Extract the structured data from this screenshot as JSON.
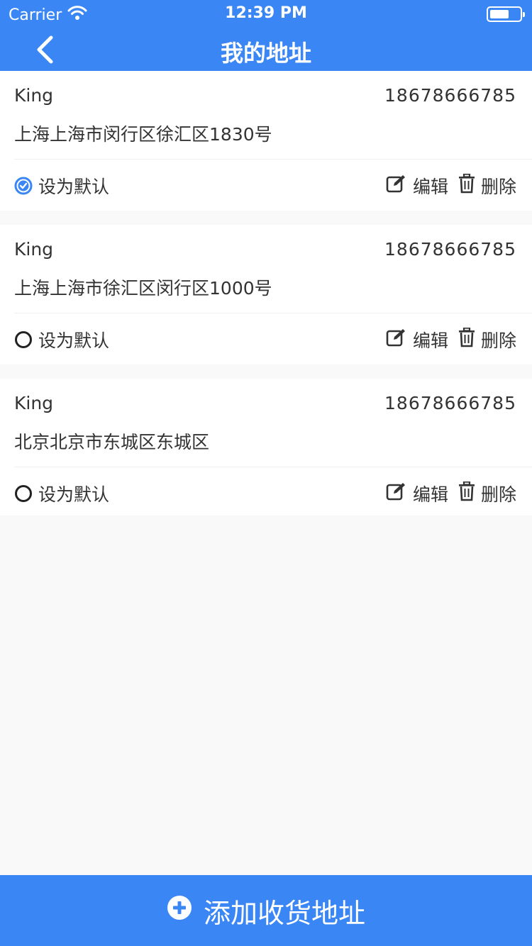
{
  "status_bar": {
    "carrier": "Carrier",
    "time": "12:39 PM"
  },
  "header": {
    "title": "我的地址"
  },
  "addresses": [
    {
      "name": "King",
      "phone": "18678666785",
      "address": "上海上海市闵行区徐汇区1830号",
      "default_label": "设为默认",
      "is_default": true,
      "edit_label": "编辑",
      "delete_label": "删除"
    },
    {
      "name": "King",
      "phone": "18678666785",
      "address": "上海上海市徐汇区闵行区1000号",
      "default_label": "设为默认",
      "is_default": false,
      "edit_label": "编辑",
      "delete_label": "删除"
    },
    {
      "name": "King",
      "phone": "18678666785",
      "address": "北京北京市东城区东城区",
      "default_label": "设为默认",
      "is_default": false,
      "edit_label": "编辑",
      "delete_label": "删除"
    }
  ],
  "footer": {
    "add_label": "添加收货地址"
  },
  "colors": {
    "accent": "#3a86f5",
    "background": "#f9f9f9"
  }
}
